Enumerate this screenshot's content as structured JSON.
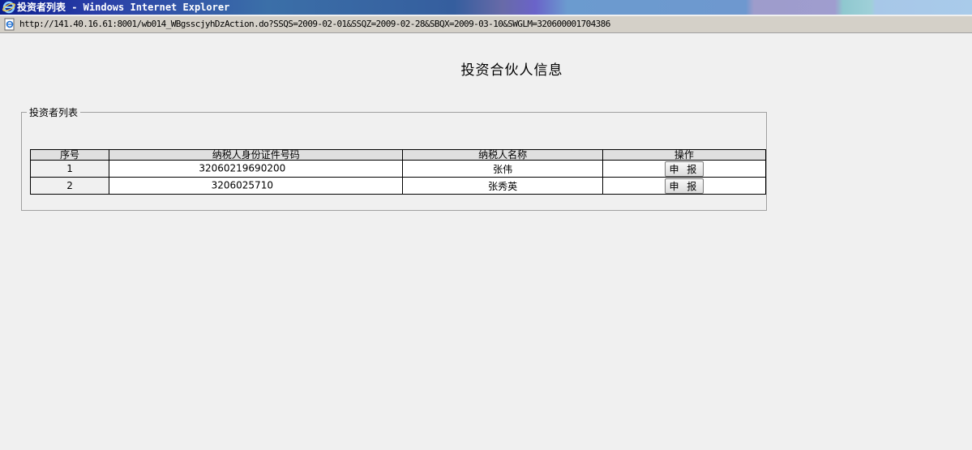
{
  "window": {
    "title": "投资者列表 - Windows Internet Explorer"
  },
  "address": {
    "url": "http://141.40.16.61:8001/wb014_WBgsscjyhDzAction.do?SSQS=2009-02-01&SSQZ=2009-02-28&SBQX=2009-03-10&SWGLM=320600001704386"
  },
  "page": {
    "title": "投资合伙人信息",
    "fieldset_legend": "投资者列表"
  },
  "table": {
    "headers": [
      "序号",
      "纳税人身份证件号码",
      "纳税人名称",
      "操作"
    ],
    "rows": [
      {
        "seq": "1",
        "id_number": "32060219690200",
        "name": "张伟",
        "action": "申 报"
      },
      {
        "seq": "2",
        "id_number": "3206025710",
        "name": "张秀英",
        "action": "申 报"
      }
    ]
  }
}
